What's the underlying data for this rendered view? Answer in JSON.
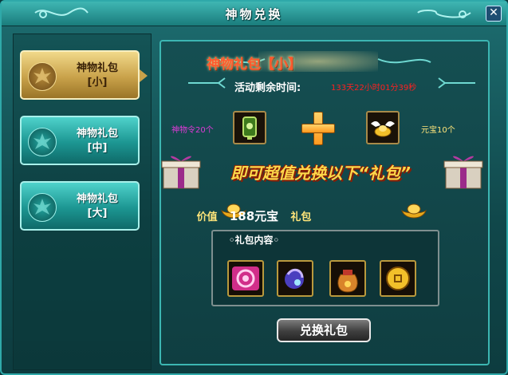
{
  "window": {
    "title": "神物兑换"
  },
  "tabs": [
    {
      "label_line1": "神物礼包",
      "label_line2": "[小]",
      "active": true
    },
    {
      "label_line1": "神物礼包",
      "label_line2": "[中]",
      "active": false
    },
    {
      "label_line1": "神物礼包",
      "label_line2": "[大]",
      "active": false
    }
  ],
  "pack": {
    "title": "神物礼包【小】",
    "remain_label": "活动剩余时间:",
    "remain_value": "133天22小时01分39秒"
  },
  "cost": {
    "left_label": "神物令20个",
    "right_label": "元宝10个"
  },
  "banner": {
    "text": "即可超值兑换以下“礼包”"
  },
  "value_line": {
    "prefix": "价值",
    "amount": "188元宝",
    "suffix": "礼包"
  },
  "contents": {
    "title": "◦礼包内容◦"
  },
  "exchange_button": {
    "label": "兑换礼包"
  },
  "colors": {
    "accent_teal": "#1d8f8c",
    "active_tab_gold": "#c9a24a",
    "countdown_red": "#ff2020",
    "title_orange": "#ff5a2e"
  }
}
